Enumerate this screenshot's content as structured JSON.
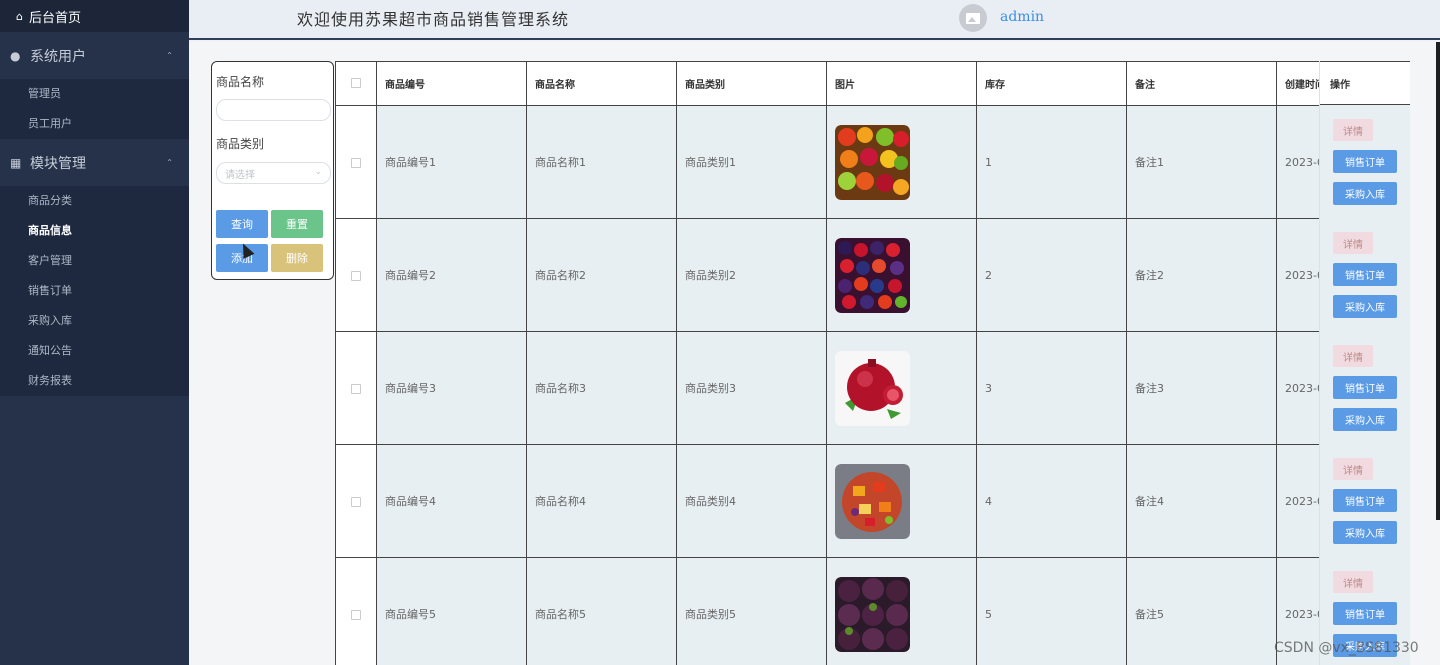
{
  "sidebar": {
    "home_label": "后台首页",
    "groups": [
      {
        "label": "系统用户",
        "items": [
          "管理员",
          "员工用户"
        ]
      },
      {
        "label": "模块管理",
        "items": [
          "商品分类",
          "商品信息",
          "客户管理",
          "销售订单",
          "采购入库",
          "通知公告",
          "财务报表"
        ]
      }
    ],
    "active_item": "商品信息"
  },
  "header": {
    "title": "欢迎使用苏果超市商品销售管理系统",
    "username": "admin"
  },
  "search": {
    "name_label": "商品名称",
    "name_value": "",
    "category_label": "商品类别",
    "category_placeholder": "请选择",
    "query_label": "查询",
    "reset_label": "重置",
    "add_label": "添加",
    "delete_label": "删除"
  },
  "table": {
    "columns": [
      "商品编号",
      "商品名称",
      "商品类别",
      "图片",
      "库存",
      "备注",
      "创建时间",
      "操作"
    ],
    "rows": [
      {
        "code": "商品编号1",
        "name": "商品名称1",
        "category": "商品类别1",
        "image": "mixed-fruit",
        "stock": "1",
        "note": "备注1",
        "created": "2023-0"
      },
      {
        "code": "商品编号2",
        "name": "商品名称2",
        "category": "商品类别2",
        "image": "berries",
        "stock": "2",
        "note": "备注2",
        "created": "2023-0"
      },
      {
        "code": "商品编号3",
        "name": "商品名称3",
        "category": "商品类别3",
        "image": "pomegranate",
        "stock": "3",
        "note": "备注3",
        "created": "2023-0"
      },
      {
        "code": "商品编号4",
        "name": "商品名称4",
        "category": "商品类别4",
        "image": "fruit-salad",
        "stock": "4",
        "note": "备注4",
        "created": "2023-0"
      },
      {
        "code": "商品编号5",
        "name": "商品名称5",
        "category": "商品类别5",
        "image": "mangosteen",
        "stock": "5",
        "note": "备注5",
        "created": "2023-0"
      }
    ],
    "row_actions": {
      "detail": "详情",
      "sales_order": "销售订单",
      "purchase_in": "采购入库"
    }
  },
  "watermark": "CSDN @vx_BS81330",
  "colors": {
    "sidebar": "#263249",
    "primary": "#5b9be6",
    "success": "#6bc48a",
    "warning": "#d9c27a",
    "detail": "#f1dbe0"
  }
}
